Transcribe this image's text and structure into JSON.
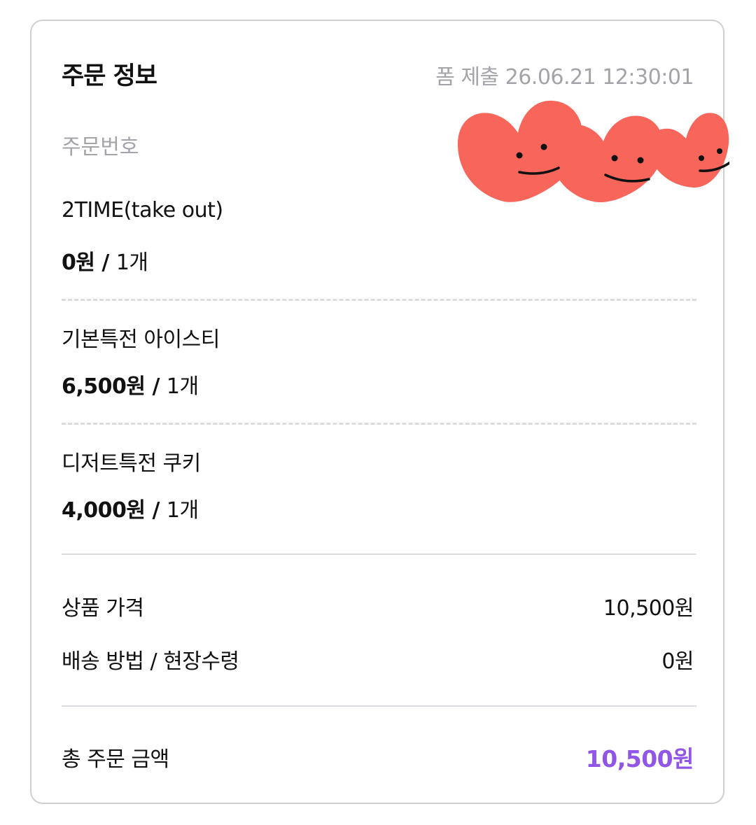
{
  "order": {
    "title": "주문 정보",
    "submitted": "폼 제출 26.06.21 12:30:01",
    "order_number_label": "주문번호"
  },
  "items": [
    {
      "name": "2TIME(take out)",
      "price": "0원",
      "separator": " / ",
      "qty": "1개"
    },
    {
      "name": "기본특전 아이스티",
      "price": "6,500원",
      "separator": " / ",
      "qty": "1개"
    },
    {
      "name": "디저트특전 쿠키",
      "price": "4,000원",
      "separator": " / ",
      "qty": "1개"
    }
  ],
  "summary": {
    "product_price_label": "상품 가격",
    "product_price_value": "10,500원",
    "delivery_label": "배송 방법 / 현장수령",
    "delivery_value": "0원",
    "total_label": "총 주문 금액",
    "total_value": "10,500원"
  },
  "colors": {
    "accent": "#9156e6",
    "muted_text": "#a3a3aa",
    "sticker": "#f8655a"
  },
  "decorations": {
    "sticker_icon": "smiling-heart-sticker"
  }
}
